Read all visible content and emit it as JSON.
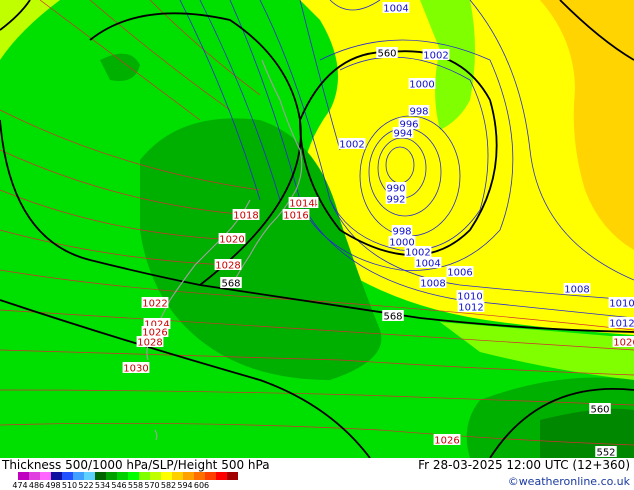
{
  "caption": "Thickness 500/1000 hPa/SLP/Height 500 hPa",
  "valid_time": "Fr 28-03-2025 12:00 UTC (12+360)",
  "copyright": "©weatheronline.co.uk",
  "legend": {
    "labels": [
      "474",
      "486",
      "498",
      "510",
      "522",
      "534",
      "546",
      "558",
      "570",
      "582",
      "594",
      "606"
    ],
    "colors": [
      "#c000c0",
      "#e040e0",
      "#ff66ff",
      "#1010a0",
      "#2050ff",
      "#40a0ff",
      "#60d0ff",
      "#006400",
      "#00a000",
      "#00d000",
      "#00ff00",
      "#80ff00",
      "#c0ff00",
      "#ffff00",
      "#ffd000",
      "#ffa000",
      "#ff7000",
      "#ff4000",
      "#ff0000",
      "#a00000"
    ]
  },
  "map": {
    "slp_labels": [
      "1004",
      "1002",
      "1000",
      "998",
      "996",
      "994",
      "1002",
      "990",
      "992",
      "998",
      "1000",
      "1002",
      "1004",
      "1006",
      "1008",
      "1010",
      "1012",
      "1008",
      "1010",
      "1012",
      "1014",
      "1016",
      "1018",
      "1020",
      "1022",
      "1024",
      "1026",
      "1028",
      "1030",
      "1026",
      "1028",
      "1026",
      "1014"
    ],
    "height_labels": [
      "560",
      "568",
      "568",
      "560",
      "552"
    ]
  }
}
